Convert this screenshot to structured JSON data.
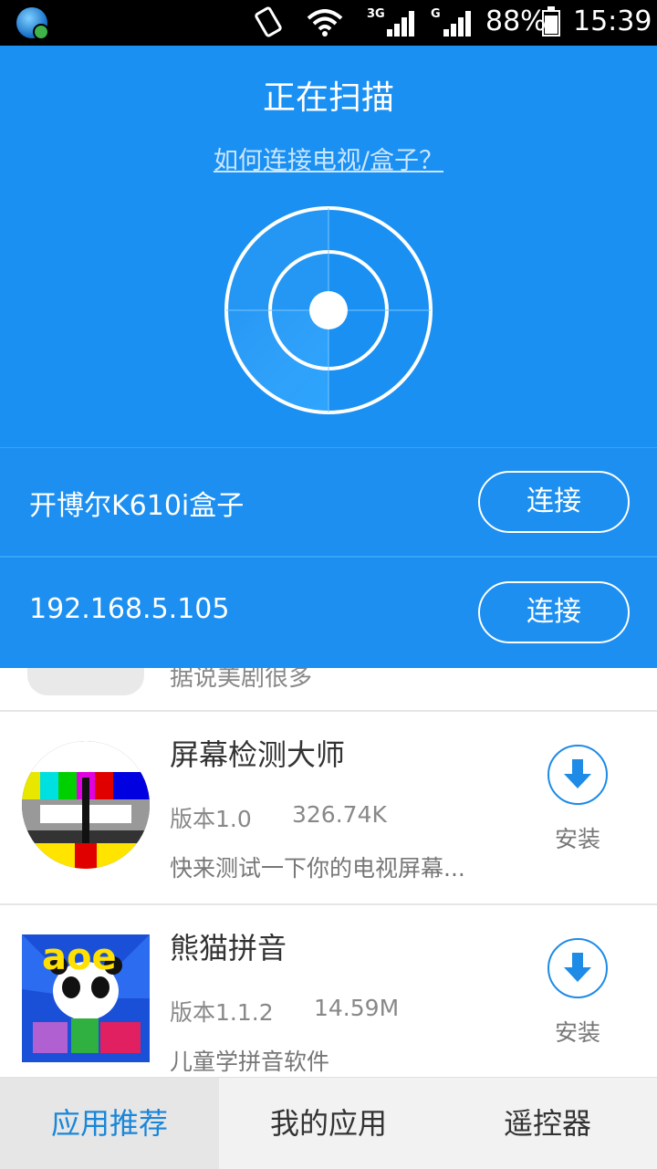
{
  "status_bar": {
    "network_1": "3G",
    "network_2": "G",
    "battery": "88%",
    "time": "15:39"
  },
  "scan_panel": {
    "title": "正在扫描",
    "help_link": "如何连接电视/盒子？",
    "devices": [
      {
        "name": "开博尔K610i盒子",
        "button": "连接"
      },
      {
        "name": "192.168.5.105",
        "button": "连接"
      }
    ]
  },
  "app_list": {
    "partial_desc": "据说美剧很多",
    "apps": [
      {
        "name": "屏幕检测大师",
        "version": "版本1.0",
        "size": "326.74K",
        "desc": "快来测试一下你的电视屏幕...",
        "action": "安装"
      },
      {
        "name": "熊猫拼音",
        "version": "版本1.1.2",
        "size": "14.59M",
        "desc": "儿童学拼音软件",
        "action": "安装"
      }
    ],
    "panda_icon_text": "aoe"
  },
  "tabs": [
    {
      "label": "应用推荐",
      "active": true
    },
    {
      "label": "我的应用",
      "active": false
    },
    {
      "label": "遥控器",
      "active": false
    }
  ],
  "colors": {
    "accent": "#1a90f2",
    "active_tab": "#1a86d9"
  }
}
